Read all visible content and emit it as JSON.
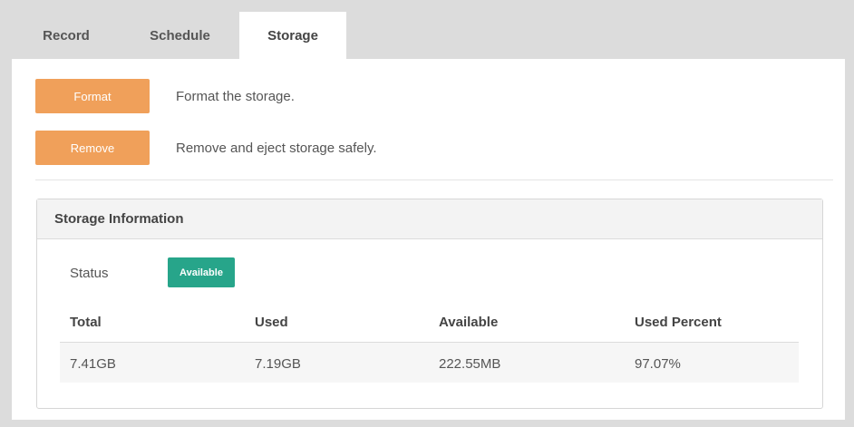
{
  "tabs": [
    {
      "label": "Record",
      "active": false
    },
    {
      "label": "Schedule",
      "active": false
    },
    {
      "label": "Storage",
      "active": true
    }
  ],
  "actions": {
    "format": {
      "label": "Format",
      "description": "Format the storage."
    },
    "remove": {
      "label": "Remove",
      "description": "Remove and eject storage safely."
    }
  },
  "storage_info": {
    "title": "Storage Information",
    "status_label": "Status",
    "status_value": "Available",
    "columns": [
      "Total",
      "Used",
      "Available",
      "Used Percent"
    ],
    "row": [
      "7.41GB",
      "7.19GB",
      "222.55MB",
      "97.07%"
    ]
  },
  "colors": {
    "button": "#f0a05a",
    "badge": "#27a58a"
  }
}
